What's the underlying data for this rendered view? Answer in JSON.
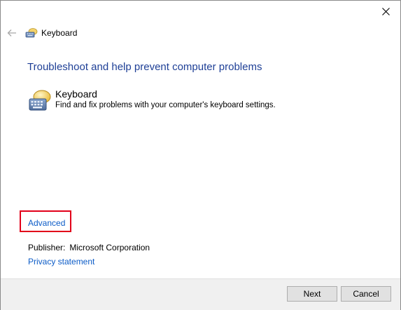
{
  "window": {
    "close_icon": "close-icon",
    "back_icon": "back-arrow-icon",
    "title": "Keyboard"
  },
  "main": {
    "heading": "Troubleshoot and help prevent computer problems",
    "item": {
      "title": "Keyboard",
      "description": "Find and fix problems with your computer's keyboard settings.",
      "icon": "keyboard-troubleshooter-icon"
    },
    "advanced_label": "Advanced",
    "publisher_label": "Publisher:",
    "publisher_value": "Microsoft Corporation",
    "privacy_label": "Privacy statement"
  },
  "footer": {
    "next_label": "Next",
    "cancel_label": "Cancel"
  },
  "colors": {
    "heading": "#1e3f96",
    "link": "#0b5bc7",
    "highlight_box": "#e2001a"
  }
}
